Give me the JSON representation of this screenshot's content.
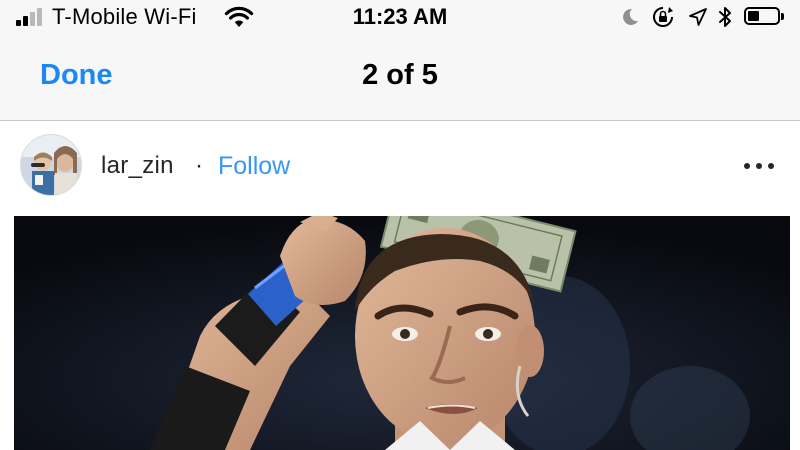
{
  "status_bar": {
    "carrier": "T-Mobile Wi-Fi",
    "time": "11:23 AM",
    "signal_bars_filled": 2,
    "signal_bars_total": 4,
    "battery_level": 0.4,
    "icons": [
      "signal-icon",
      "wifi-icon",
      "moon-icon",
      "orientation-lock-icon",
      "location-arrow-icon",
      "bluetooth-icon",
      "battery-icon"
    ]
  },
  "nav": {
    "done_label": "Done",
    "title": "2 of 5"
  },
  "post": {
    "username": "lar_zin",
    "separator": "·",
    "follow_label": "Follow",
    "more_icon": "ellipsis-icon"
  },
  "colors": {
    "ios_blue": "#1c88f6",
    "follow_blue": "#3897f0",
    "nav_bg": "#f7f7f7",
    "text_dark": "#262626"
  }
}
